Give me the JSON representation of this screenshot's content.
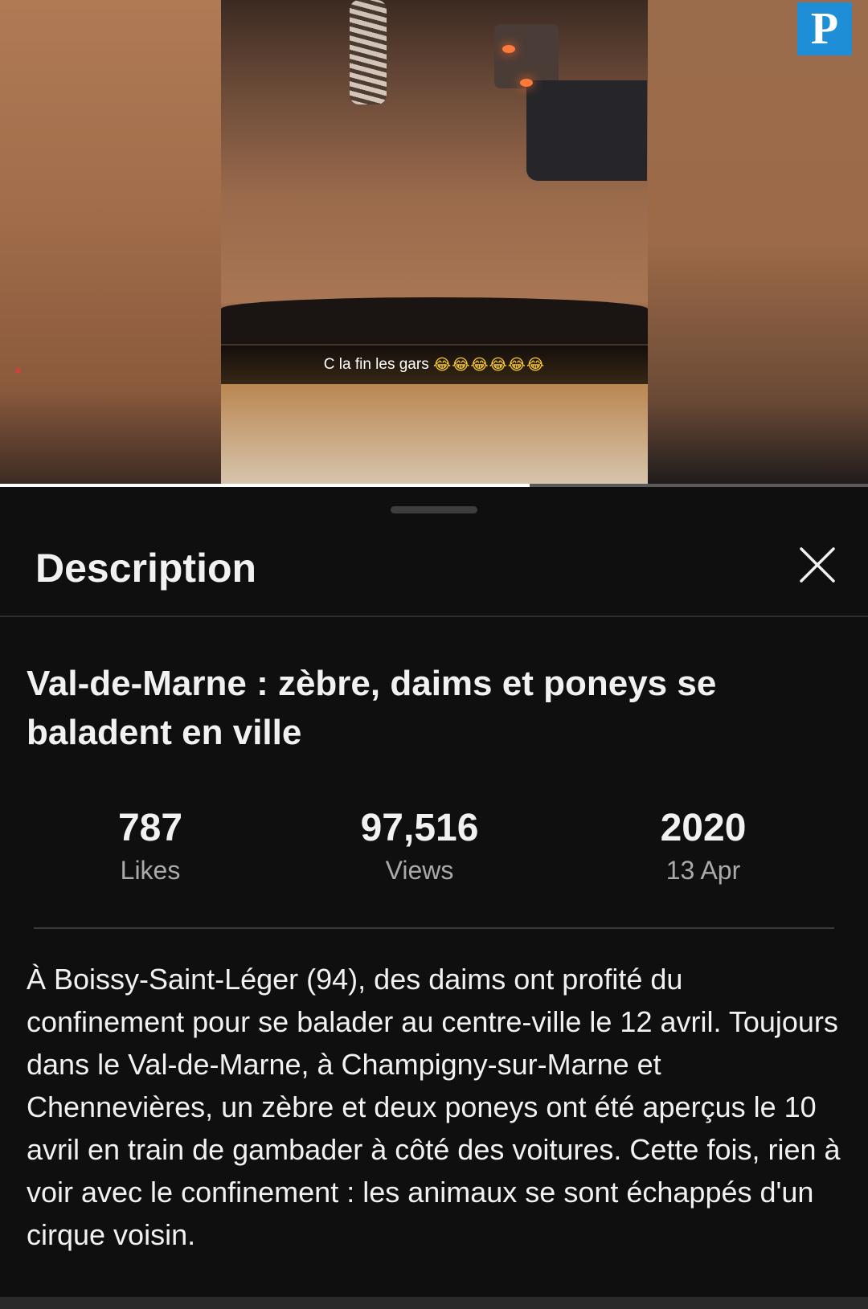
{
  "video": {
    "caption": "C la fin les gars",
    "caption_emoji": "😂😂😂😂😂😂",
    "logo_letter": "P",
    "progress_fraction": 0.61
  },
  "sheet": {
    "header_title": "Description",
    "close_icon": "close-icon"
  },
  "video_info": {
    "title": "Val-de-Marne : zèbre, daims et poneys se baladent en ville",
    "stats": [
      {
        "value": "787",
        "label": "Likes"
      },
      {
        "value": "97,516",
        "label": "Views"
      },
      {
        "value": "2020",
        "label": "13 Apr"
      }
    ],
    "description": "À Boissy-Saint-Léger (94), des daims ont profité du confinement pour se balader au centre-ville le 12 avril. Toujours dans le Val-de-Marne, à Champigny-sur-Marne et Chennevières, un zèbre et deux poneys ont été aperçus le 10 avril en train de gambader à côté des voitures. Cette fois, rien à voir avec le confinement : les animaux se sont échappés d'un cirque voisin."
  },
  "colors": {
    "background": "#0f0f0f",
    "logo": "#1e8fd6",
    "secondary_text": "#aaaaaa"
  }
}
